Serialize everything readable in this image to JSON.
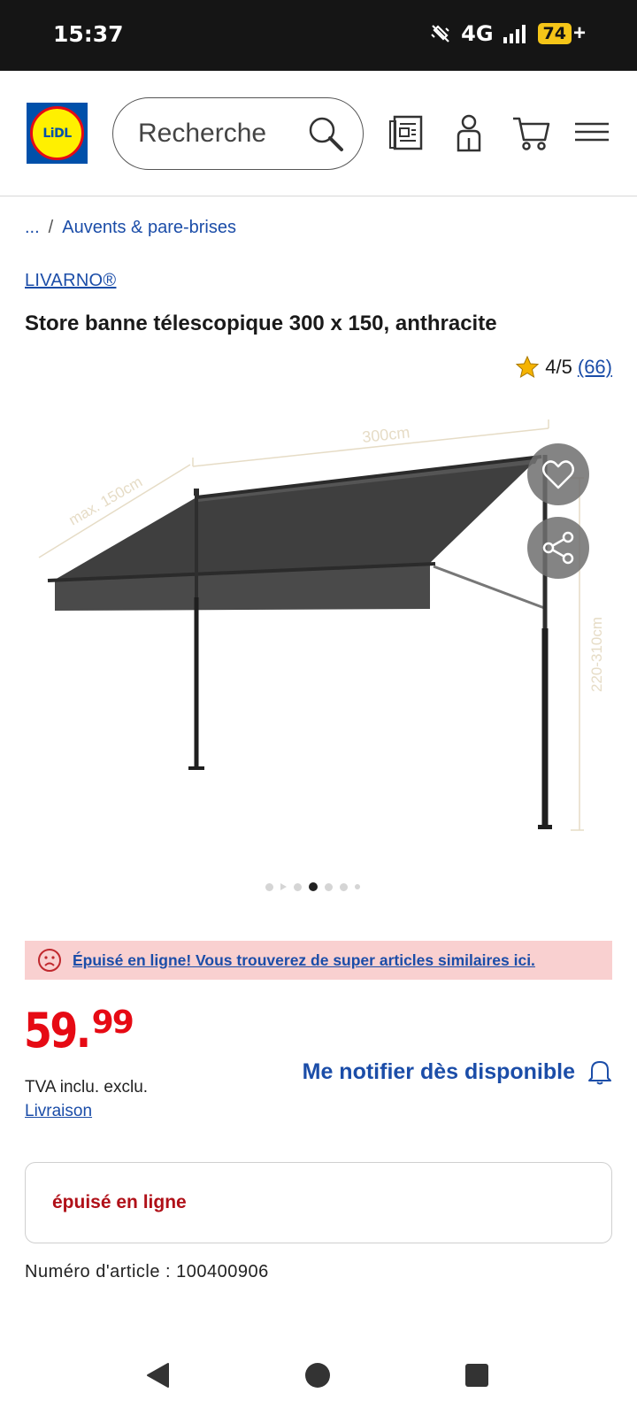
{
  "status_bar": {
    "time": "15:37",
    "network": "4G",
    "battery": "74",
    "battery_suffix": "+"
  },
  "header": {
    "logo_text": "LiDL",
    "search": {
      "placeholder": "Recherche"
    }
  },
  "breadcrumb": {
    "ellipsis": "...",
    "separator": "/",
    "current": "Auvents & pare-brises"
  },
  "product": {
    "brand": "LIVARNO®",
    "title": "Store banne télescopique 300 x 150, anthracite",
    "rating": {
      "score": "4/5",
      "count": "(66)"
    },
    "image_labels": {
      "width": "300cm",
      "depth": "max. 150cm",
      "height": "220-310cm"
    },
    "gallery": {
      "total": 7,
      "active": 4
    }
  },
  "alert": {
    "text": "Épuisé en ligne! Vous trouverez de super articles similaires ici."
  },
  "price": {
    "integer": "59.",
    "decimal": "99",
    "vat": "TVA inclu. exclu.",
    "delivery": "Livraison"
  },
  "notify": {
    "label": "Me notifier dès disponible"
  },
  "stock": {
    "status": "épuisé en ligne"
  },
  "article": {
    "number": "Numéro d'article : 100400906"
  },
  "colors": {
    "lidl_blue": "#0050aa",
    "lidl_red": "#e60a14",
    "lidl_yellow": "#fff000",
    "link": "#1b4da8",
    "alert_bg": "#f9d0d0"
  }
}
